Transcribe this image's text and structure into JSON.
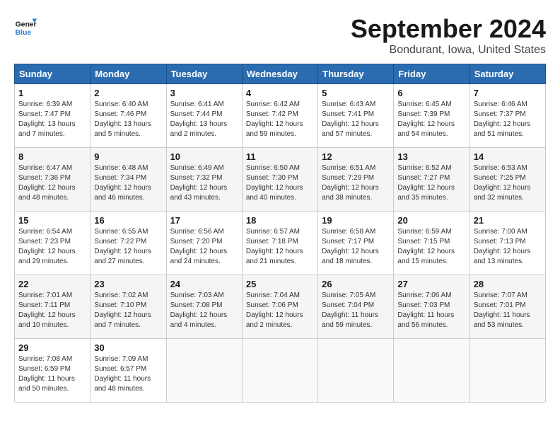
{
  "header": {
    "logo_line1": "General",
    "logo_line2": "Blue",
    "month": "September 2024",
    "location": "Bondurant, Iowa, United States"
  },
  "weekdays": [
    "Sunday",
    "Monday",
    "Tuesday",
    "Wednesday",
    "Thursday",
    "Friday",
    "Saturday"
  ],
  "weeks": [
    [
      {
        "day": "1",
        "info": "Sunrise: 6:39 AM\nSunset: 7:47 PM\nDaylight: 13 hours\nand 7 minutes."
      },
      {
        "day": "2",
        "info": "Sunrise: 6:40 AM\nSunset: 7:46 PM\nDaylight: 13 hours\nand 5 minutes."
      },
      {
        "day": "3",
        "info": "Sunrise: 6:41 AM\nSunset: 7:44 PM\nDaylight: 13 hours\nand 2 minutes."
      },
      {
        "day": "4",
        "info": "Sunrise: 6:42 AM\nSunset: 7:42 PM\nDaylight: 12 hours\nand 59 minutes."
      },
      {
        "day": "5",
        "info": "Sunrise: 6:43 AM\nSunset: 7:41 PM\nDaylight: 12 hours\nand 57 minutes."
      },
      {
        "day": "6",
        "info": "Sunrise: 6:45 AM\nSunset: 7:39 PM\nDaylight: 12 hours\nand 54 minutes."
      },
      {
        "day": "7",
        "info": "Sunrise: 6:46 AM\nSunset: 7:37 PM\nDaylight: 12 hours\nand 51 minutes."
      }
    ],
    [
      {
        "day": "8",
        "info": "Sunrise: 6:47 AM\nSunset: 7:36 PM\nDaylight: 12 hours\nand 48 minutes."
      },
      {
        "day": "9",
        "info": "Sunrise: 6:48 AM\nSunset: 7:34 PM\nDaylight: 12 hours\nand 46 minutes."
      },
      {
        "day": "10",
        "info": "Sunrise: 6:49 AM\nSunset: 7:32 PM\nDaylight: 12 hours\nand 43 minutes."
      },
      {
        "day": "11",
        "info": "Sunrise: 6:50 AM\nSunset: 7:30 PM\nDaylight: 12 hours\nand 40 minutes."
      },
      {
        "day": "12",
        "info": "Sunrise: 6:51 AM\nSunset: 7:29 PM\nDaylight: 12 hours\nand 38 minutes."
      },
      {
        "day": "13",
        "info": "Sunrise: 6:52 AM\nSunset: 7:27 PM\nDaylight: 12 hours\nand 35 minutes."
      },
      {
        "day": "14",
        "info": "Sunrise: 6:53 AM\nSunset: 7:25 PM\nDaylight: 12 hours\nand 32 minutes."
      }
    ],
    [
      {
        "day": "15",
        "info": "Sunrise: 6:54 AM\nSunset: 7:23 PM\nDaylight: 12 hours\nand 29 minutes."
      },
      {
        "day": "16",
        "info": "Sunrise: 6:55 AM\nSunset: 7:22 PM\nDaylight: 12 hours\nand 27 minutes."
      },
      {
        "day": "17",
        "info": "Sunrise: 6:56 AM\nSunset: 7:20 PM\nDaylight: 12 hours\nand 24 minutes."
      },
      {
        "day": "18",
        "info": "Sunrise: 6:57 AM\nSunset: 7:18 PM\nDaylight: 12 hours\nand 21 minutes."
      },
      {
        "day": "19",
        "info": "Sunrise: 6:58 AM\nSunset: 7:17 PM\nDaylight: 12 hours\nand 18 minutes."
      },
      {
        "day": "20",
        "info": "Sunrise: 6:59 AM\nSunset: 7:15 PM\nDaylight: 12 hours\nand 15 minutes."
      },
      {
        "day": "21",
        "info": "Sunrise: 7:00 AM\nSunset: 7:13 PM\nDaylight: 12 hours\nand 13 minutes."
      }
    ],
    [
      {
        "day": "22",
        "info": "Sunrise: 7:01 AM\nSunset: 7:11 PM\nDaylight: 12 hours\nand 10 minutes."
      },
      {
        "day": "23",
        "info": "Sunrise: 7:02 AM\nSunset: 7:10 PM\nDaylight: 12 hours\nand 7 minutes."
      },
      {
        "day": "24",
        "info": "Sunrise: 7:03 AM\nSunset: 7:08 PM\nDaylight: 12 hours\nand 4 minutes."
      },
      {
        "day": "25",
        "info": "Sunrise: 7:04 AM\nSunset: 7:06 PM\nDaylight: 12 hours\nand 2 minutes."
      },
      {
        "day": "26",
        "info": "Sunrise: 7:05 AM\nSunset: 7:04 PM\nDaylight: 11 hours\nand 59 minutes."
      },
      {
        "day": "27",
        "info": "Sunrise: 7:06 AM\nSunset: 7:03 PM\nDaylight: 11 hours\nand 56 minutes."
      },
      {
        "day": "28",
        "info": "Sunrise: 7:07 AM\nSunset: 7:01 PM\nDaylight: 11 hours\nand 53 minutes."
      }
    ],
    [
      {
        "day": "29",
        "info": "Sunrise: 7:08 AM\nSunset: 6:59 PM\nDaylight: 11 hours\nand 50 minutes."
      },
      {
        "day": "30",
        "info": "Sunrise: 7:09 AM\nSunset: 6:57 PM\nDaylight: 11 hours\nand 48 minutes."
      },
      {
        "day": "",
        "info": ""
      },
      {
        "day": "",
        "info": ""
      },
      {
        "day": "",
        "info": ""
      },
      {
        "day": "",
        "info": ""
      },
      {
        "day": "",
        "info": ""
      }
    ]
  ]
}
